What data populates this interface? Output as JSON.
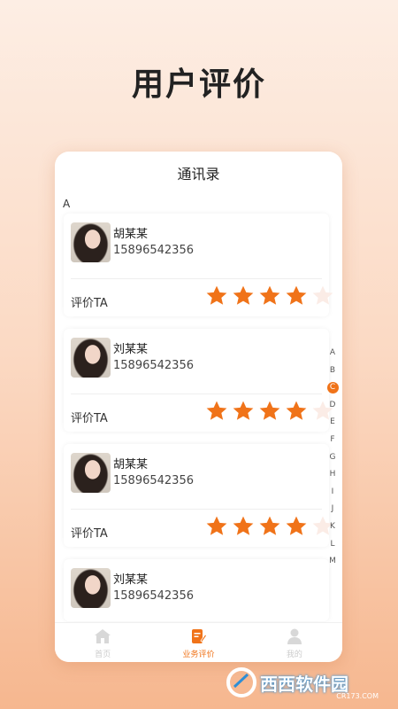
{
  "headline": "用户评价",
  "screen": {
    "title": "通讯录",
    "section_letter": "A",
    "rate_label": "评价TA",
    "contacts": [
      {
        "name": "胡某某",
        "phone": "15896542356",
        "rating": 4,
        "max_rating": 5
      },
      {
        "name": "刘某某",
        "phone": "15896542356",
        "rating": 4,
        "max_rating": 5
      },
      {
        "name": "胡某某",
        "phone": "15896542356",
        "rating": 4,
        "max_rating": 5
      },
      {
        "name": "刘某某",
        "phone": "15896542356"
      }
    ],
    "index_letters": [
      "A",
      "B",
      "C",
      "D",
      "E",
      "F",
      "G",
      "H",
      "I",
      "J",
      "K",
      "L",
      "M"
    ],
    "index_active": "C"
  },
  "tabbar": {
    "tabs": [
      {
        "label": "首页",
        "icon": "home-icon"
      },
      {
        "label": "业务评价",
        "icon": "edit-icon",
        "active": true
      },
      {
        "label": "我的",
        "icon": "user-icon"
      }
    ]
  },
  "watermark": {
    "text": "西西软件园",
    "sub": "CR173.COM"
  },
  "colors": {
    "accent": "#f07319",
    "star_empty": "#fbece6"
  }
}
